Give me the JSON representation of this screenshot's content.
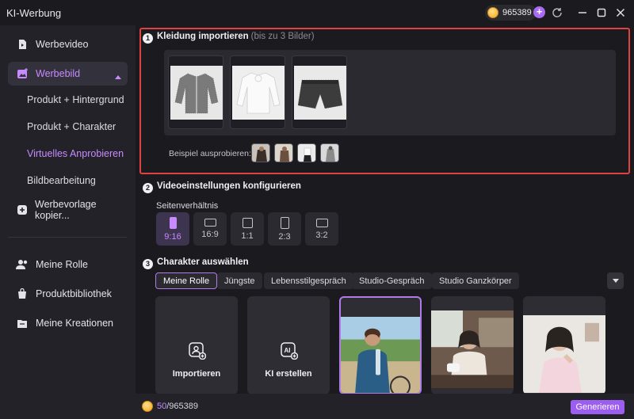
{
  "app": {
    "title": "KI-Werbung"
  },
  "titlebar": {
    "credits": "965389"
  },
  "sidebar": {
    "werbevideo": "Werbevideo",
    "werbebild": "Werbebild",
    "sub": [
      "Produkt + Hintergrund",
      "Produkt + Charakter",
      "Virtuelles Anprobieren",
      "Bildbearbeitung"
    ],
    "werbevorlage": "Werbevorlage kopier...",
    "meine_rolle": "Meine Rolle",
    "produktbibliothek": "Produktbibliothek",
    "meine_kreationen": "Meine Kreationen"
  },
  "step1": {
    "num": "1",
    "title": "Kleidung importieren",
    "hint": "(bis zu 3 Bilder)",
    "try_label": "Beispiel ausprobieren:"
  },
  "step2": {
    "num": "2",
    "title": "Videoeinstellungen konfigurieren",
    "ratio_label": "Seitenverhältnis",
    "ratios": [
      "9:16",
      "16:9",
      "1:1",
      "2:3",
      "3:2"
    ],
    "selected_ratio": "9:16"
  },
  "step3": {
    "num": "3",
    "title": "Charakter auswählen",
    "tabs": [
      "Meine Rolle",
      "Jüngste",
      "Lebensstilgespräch",
      "Studio-Gespräch",
      "Studio Ganzkörper"
    ],
    "cards": {
      "import": "Importieren",
      "create": "KI erstellen"
    }
  },
  "bottombar": {
    "used": "50",
    "total": "/965389",
    "generate": "Generieren"
  },
  "colors": {
    "accent": "#b07be8",
    "highlight": "#e0423f",
    "button": "#9c5ef0"
  }
}
